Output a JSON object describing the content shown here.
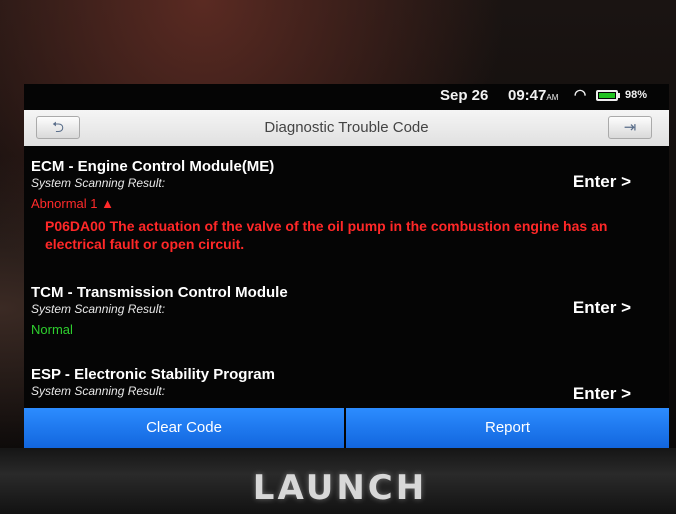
{
  "statusbar": {
    "date": "Sep 26",
    "time": "09:47",
    "time_suffix": "AM",
    "battery": "98%",
    "battery_level": 0.98
  },
  "header": {
    "title": "Diagnostic Trouble Code"
  },
  "modules": [
    {
      "title": "ECM - Engine Control Module(ME)",
      "subtitle": "System Scanning Result:",
      "enter": "Enter >",
      "status": "Abnormal 1",
      "dtc": "P06DA00 The actuation of the valve of the oil pump in the combustion engine has an electrical fault or open circuit."
    },
    {
      "title": "TCM - Transmission Control Module",
      "subtitle": "System Scanning Result:",
      "enter": "Enter >",
      "status": "Normal"
    },
    {
      "title": "ESP - Electronic Stability Program",
      "subtitle": "System Scanning Result:",
      "enter": "Enter >"
    }
  ],
  "actions": {
    "clear_label": "Clear Code",
    "report_label": "Report"
  },
  "device": {
    "brand": "LAUNCH"
  },
  "colors": {
    "accent": "#1a78f0",
    "error": "#ff2a2a",
    "ok": "#2ed02e"
  },
  "icons": [
    "back-arrow-icon",
    "exit-icon",
    "warning-triangle-icon",
    "wifi-icon",
    "battery-icon"
  ]
}
